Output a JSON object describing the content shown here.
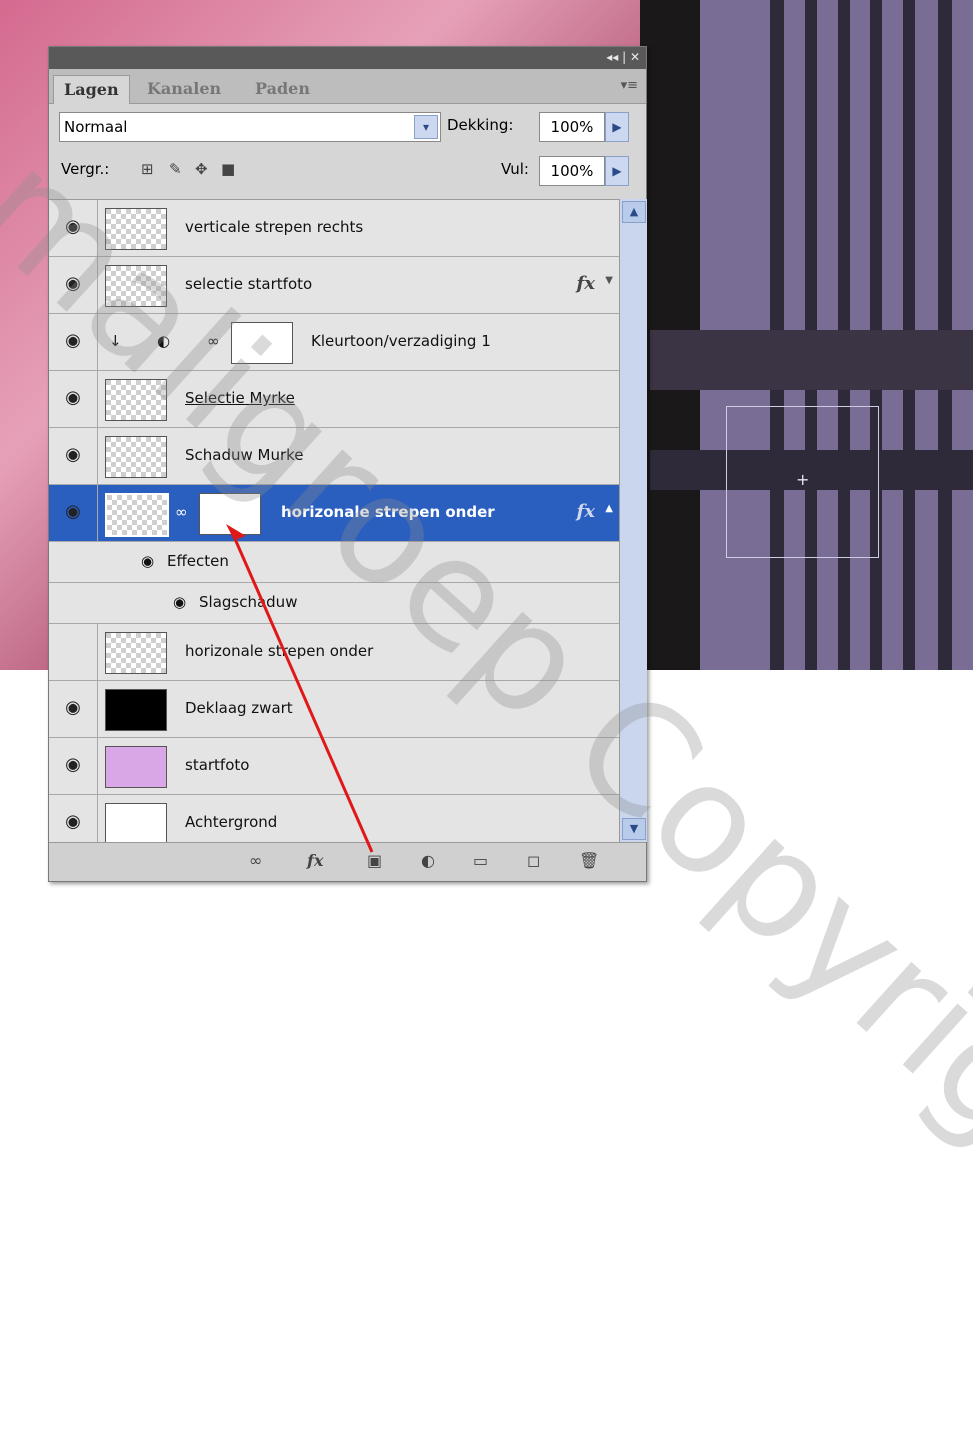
{
  "panel": {
    "tabs": [
      "Lagen",
      "Kanalen",
      "Paden"
    ],
    "blend_mode": "Normaal",
    "opacity_label": "Dekking:",
    "opacity_value": "100%",
    "lock_label": "Vergr.:",
    "fill_label": "Vul:",
    "fill_value": "100%"
  },
  "layers": [
    {
      "name": "verticale strepen rechts",
      "visible": true,
      "fx": false
    },
    {
      "name": "selectie startfoto",
      "visible": true,
      "fx": true
    },
    {
      "name": "Kleurtoon/verzadiging 1",
      "visible": true,
      "fx": false
    },
    {
      "name": "Selectie Myrke",
      "visible": true,
      "fx": false
    },
    {
      "name": "Schaduw Murke",
      "visible": true,
      "fx": false
    },
    {
      "name": "horizonale strepen onder",
      "visible": true,
      "fx": true,
      "selected": true
    },
    {
      "name": "horizonale strepen onder",
      "visible": false,
      "fx": false
    },
    {
      "name": "Deklaag zwart",
      "visible": true,
      "fx": false
    },
    {
      "name": "startfoto",
      "visible": true,
      "fx": false
    },
    {
      "name": "Achtergrond",
      "visible": true,
      "fx": false
    }
  ],
  "effects": {
    "label": "Effecten",
    "items": [
      "Slagschaduw"
    ]
  },
  "watermark": "maligroep Copyright ph"
}
